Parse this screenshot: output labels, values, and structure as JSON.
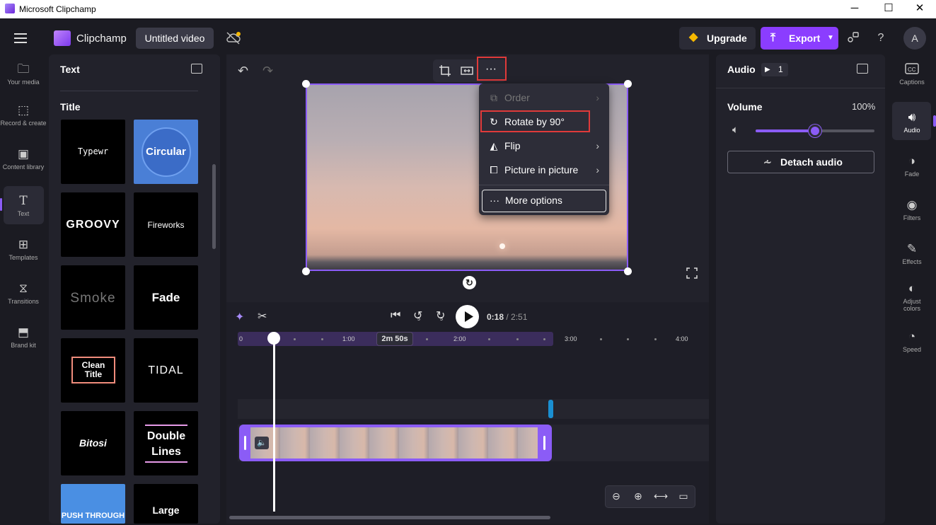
{
  "window": {
    "title": "Microsoft Clipchamp",
    "minimize": "─",
    "maximize": "☐",
    "close": "✕"
  },
  "header": {
    "app_name": "Clipchamp",
    "project_name": "Untitled video",
    "upgrade_label": "Upgrade",
    "export_label": "Export",
    "avatar_initial": "A",
    "help": "?"
  },
  "left_rail": [
    {
      "label": "Your media",
      "icon": "folder-icon"
    },
    {
      "label": "Record & create",
      "icon": "camera-icon"
    },
    {
      "label": "Content library",
      "icon": "library-icon"
    },
    {
      "label": "Text",
      "icon": "text-icon",
      "active": true
    },
    {
      "label": "Templates",
      "icon": "templates-icon"
    },
    {
      "label": "Transitions",
      "icon": "transitions-icon"
    },
    {
      "label": "Brand kit",
      "icon": "brand-kit-icon"
    }
  ],
  "text_panel": {
    "title": "Text",
    "section": "Title",
    "cards": [
      "Typewr",
      "Circular",
      "GROOVY",
      "Fireworks",
      "Smoke",
      "Fade",
      "Clean Title",
      "TIDAL",
      "Bitosi",
      "Double Lines",
      "PUSH THROUGH",
      "Large"
    ]
  },
  "context_menu": {
    "items": [
      {
        "label": "Order",
        "disabled": true
      },
      {
        "label": "Rotate by 90°"
      },
      {
        "label": "Flip"
      },
      {
        "label": "Picture in picture"
      },
      {
        "label": "More options"
      }
    ]
  },
  "playback": {
    "current": "0:18",
    "separator": " / ",
    "total": "2:51",
    "skip_back": "5",
    "skip_fwd": "5"
  },
  "timeline": {
    "ticks": [
      "0",
      "1:00",
      "2:00",
      "3:00",
      "4:00"
    ],
    "selection_duration": "2m 50s",
    "playhead_seconds": 18
  },
  "audio_panel": {
    "title": "Audio",
    "count": "1",
    "volume_label": "Volume",
    "volume_value": "100%",
    "volume_fraction": 0.5,
    "detach_label": "Detach audio"
  },
  "right_rail": [
    {
      "label": "Captions",
      "icon": "captions-icon"
    },
    {
      "label": "Audio",
      "icon": "speaker-icon",
      "active": true
    },
    {
      "label": "Fade",
      "icon": "fade-icon"
    },
    {
      "label": "Filters",
      "icon": "filters-icon"
    },
    {
      "label": "Effects",
      "icon": "effects-icon"
    },
    {
      "label": "Adjust colors",
      "icon": "adjust-colors-icon"
    },
    {
      "label": "Speed",
      "icon": "speed-icon"
    }
  ],
  "colors": {
    "accent": "#8b3dff",
    "highlight": "#e03a3a",
    "bg": "#1b1b22",
    "panel": "#22222b"
  }
}
